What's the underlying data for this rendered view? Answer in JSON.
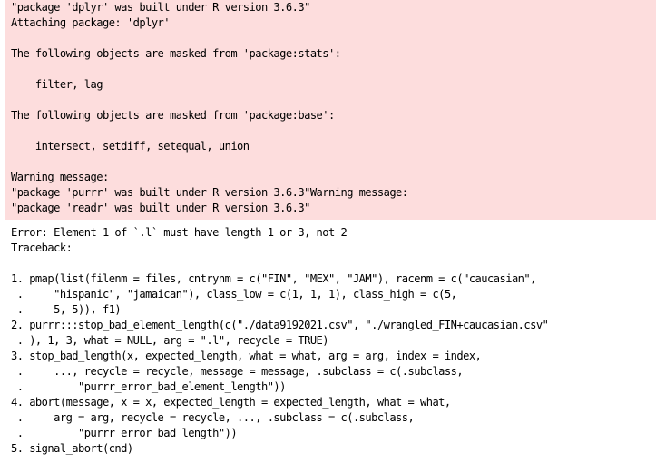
{
  "stderr": {
    "background_color": "#fddddd",
    "lines": [
      "\"package 'dplyr' was built under R version 3.6.3\"",
      "Attaching package: 'dplyr'",
      "",
      "The following objects are masked from 'package:stats':",
      "",
      "    filter, lag",
      "",
      "The following objects are masked from 'package:base':",
      "",
      "    intersect, setdiff, setequal, union",
      "",
      "Warning message:",
      "\"package 'purrr' was built under R version 3.6.3\"Warning message:",
      "\"package 'readr' was built under R version 3.6.3\""
    ]
  },
  "error": {
    "message": "Error: Element 1 of `.l` must have length 1 or 3, not 2",
    "traceback_label": "Traceback:",
    "traceback_lines": [
      "",
      "1. pmap(list(filenm = files, cntrynm = c(\"FIN\", \"MEX\", \"JAM\"), racenm = c(\"caucasian\",",
      " .     \"hispanic\", \"jamaican\"), class_low = c(1, 1, 1), class_high = c(5,",
      " .     5, 5)), f1)",
      "2. purrr:::stop_bad_element_length(c(\"./data9192021.csv\", \"./wrangled_FIN+caucasian.csv\"",
      " . ), 1, 3, what = NULL, arg = \".l\", recycle = TRUE)",
      "3. stop_bad_length(x, expected_length, what = what, arg = arg, index = index,",
      " .     ..., recycle = recycle, message = message, .subclass = c(.subclass,",
      " .         \"purrr_error_bad_element_length\"))",
      "4. abort(message, x = x, expected_length = expected_length, what = what,",
      " .     arg = arg, recycle = recycle, ..., .subclass = c(.subclass,",
      " .         \"purrr_error_bad_length\"))",
      "5. signal_abort(cnd)"
    ]
  }
}
